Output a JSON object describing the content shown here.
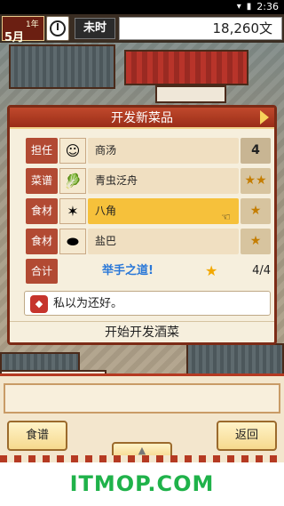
{
  "statusbar": {
    "time": "2:36"
  },
  "hud": {
    "year_label": "1年",
    "month_label": "5月",
    "time_label": "未时",
    "money": "18,260文"
  },
  "dialog": {
    "title": "开发新菜品",
    "rows": [
      {
        "label": "担任",
        "icon": "chef-portrait-icon",
        "name": "商汤",
        "value": "4"
      },
      {
        "label": "菜谱",
        "icon": "dish-icon",
        "name": "青虫泛舟",
        "value": "★★"
      },
      {
        "label": "食材",
        "icon": "star-anise-icon",
        "name": "八角",
        "value": "★"
      },
      {
        "label": "食材",
        "icon": "salt-icon",
        "name": "盐巴",
        "value": "★"
      }
    ],
    "total": {
      "label": "合计",
      "combo": "举手之道!",
      "ratio": "4/4",
      "star": "★"
    },
    "comment": "私以为还好。",
    "start_label": "开始开发酒菜"
  },
  "bottom": {
    "recipe_label": "食谱",
    "back_label": "返回",
    "up_label": "▲"
  },
  "watermark": "ITMOP.COM",
  "colors": {
    "accent": "#b24a33",
    "highlight": "#f6c13b",
    "combo": "#2a78d8"
  }
}
